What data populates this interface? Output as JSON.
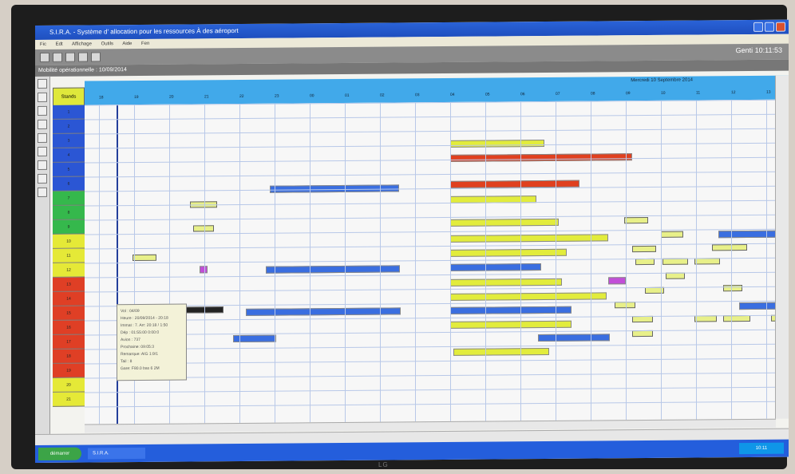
{
  "window": {
    "title": "S.I.R.A. - Système d' allocation pour les ressources À des aéroport",
    "clock": "Genti 10:11:53"
  },
  "menu": [
    "Fic",
    "Edt",
    "Affichage",
    "Outils",
    "Aide",
    "Fen"
  ],
  "header": {
    "date_bar": "Mobilité opérationnelle : 10/09/2014",
    "stand_header": "Stands",
    "timeline_date": "Mercredi 10 Septembre 2014",
    "hours": [
      "18",
      "19",
      "20",
      "21",
      "22",
      "23",
      "00",
      "01",
      "02",
      "03",
      "04",
      "05",
      "06",
      "07",
      "08",
      "09",
      "10",
      "11",
      "12",
      "13"
    ]
  },
  "stands": [
    {
      "label": "1",
      "color": "#2b56d4"
    },
    {
      "label": "2",
      "color": "#2b56d4"
    },
    {
      "label": "3",
      "color": "#2b56d4"
    },
    {
      "label": "4",
      "color": "#2b56d4"
    },
    {
      "label": "5",
      "color": "#2b56d4"
    },
    {
      "label": "6",
      "color": "#2b56d4"
    },
    {
      "label": "7",
      "color": "#35b84c"
    },
    {
      "label": "8",
      "color": "#35b84c"
    },
    {
      "label": "9",
      "color": "#35b84c"
    },
    {
      "label": "10",
      "color": "#e5e937"
    },
    {
      "label": "11",
      "color": "#e5e937"
    },
    {
      "label": "12",
      "color": "#e5e937"
    },
    {
      "label": "13",
      "color": "#df3f25"
    },
    {
      "label": "14",
      "color": "#df3f25"
    },
    {
      "label": "15",
      "color": "#df3f25"
    },
    {
      "label": "16",
      "color": "#df3f25"
    },
    {
      "label": "17",
      "color": "#df3f25"
    },
    {
      "label": "18",
      "color": "#df3f25"
    },
    {
      "label": "19",
      "color": "#df3f25"
    },
    {
      "label": "20",
      "color": "#e5e937"
    },
    {
      "label": "21",
      "color": "#e5e937"
    }
  ],
  "tooltip": {
    "lines": [
      "Vol : 04/09",
      "Heure : 20/09/2014 - 20:18",
      "Immat : 7. Arr: 20:18 / 1:50",
      "Dép : 01:55:00 0:00:0",
      "Avion : 737",
      "Prochaine: 09:05:3",
      "Remarque: AIG 1:9/1",
      "Tail : 8",
      "Gare: F80.0 bas 6 2M"
    ]
  },
  "taskbar": {
    "start": "démarrer",
    "app": "S.I.R.A.",
    "tray": "10:11"
  },
  "brand": "LG",
  "colors": {
    "titlebar": "#2a63d8",
    "timeline": "#41a9ea",
    "yellow_bar": "#e2ec3c",
    "red_bar": "#e0401f",
    "blue_bar": "#3a6ee0",
    "purple_bar": "#c24ed8"
  }
}
